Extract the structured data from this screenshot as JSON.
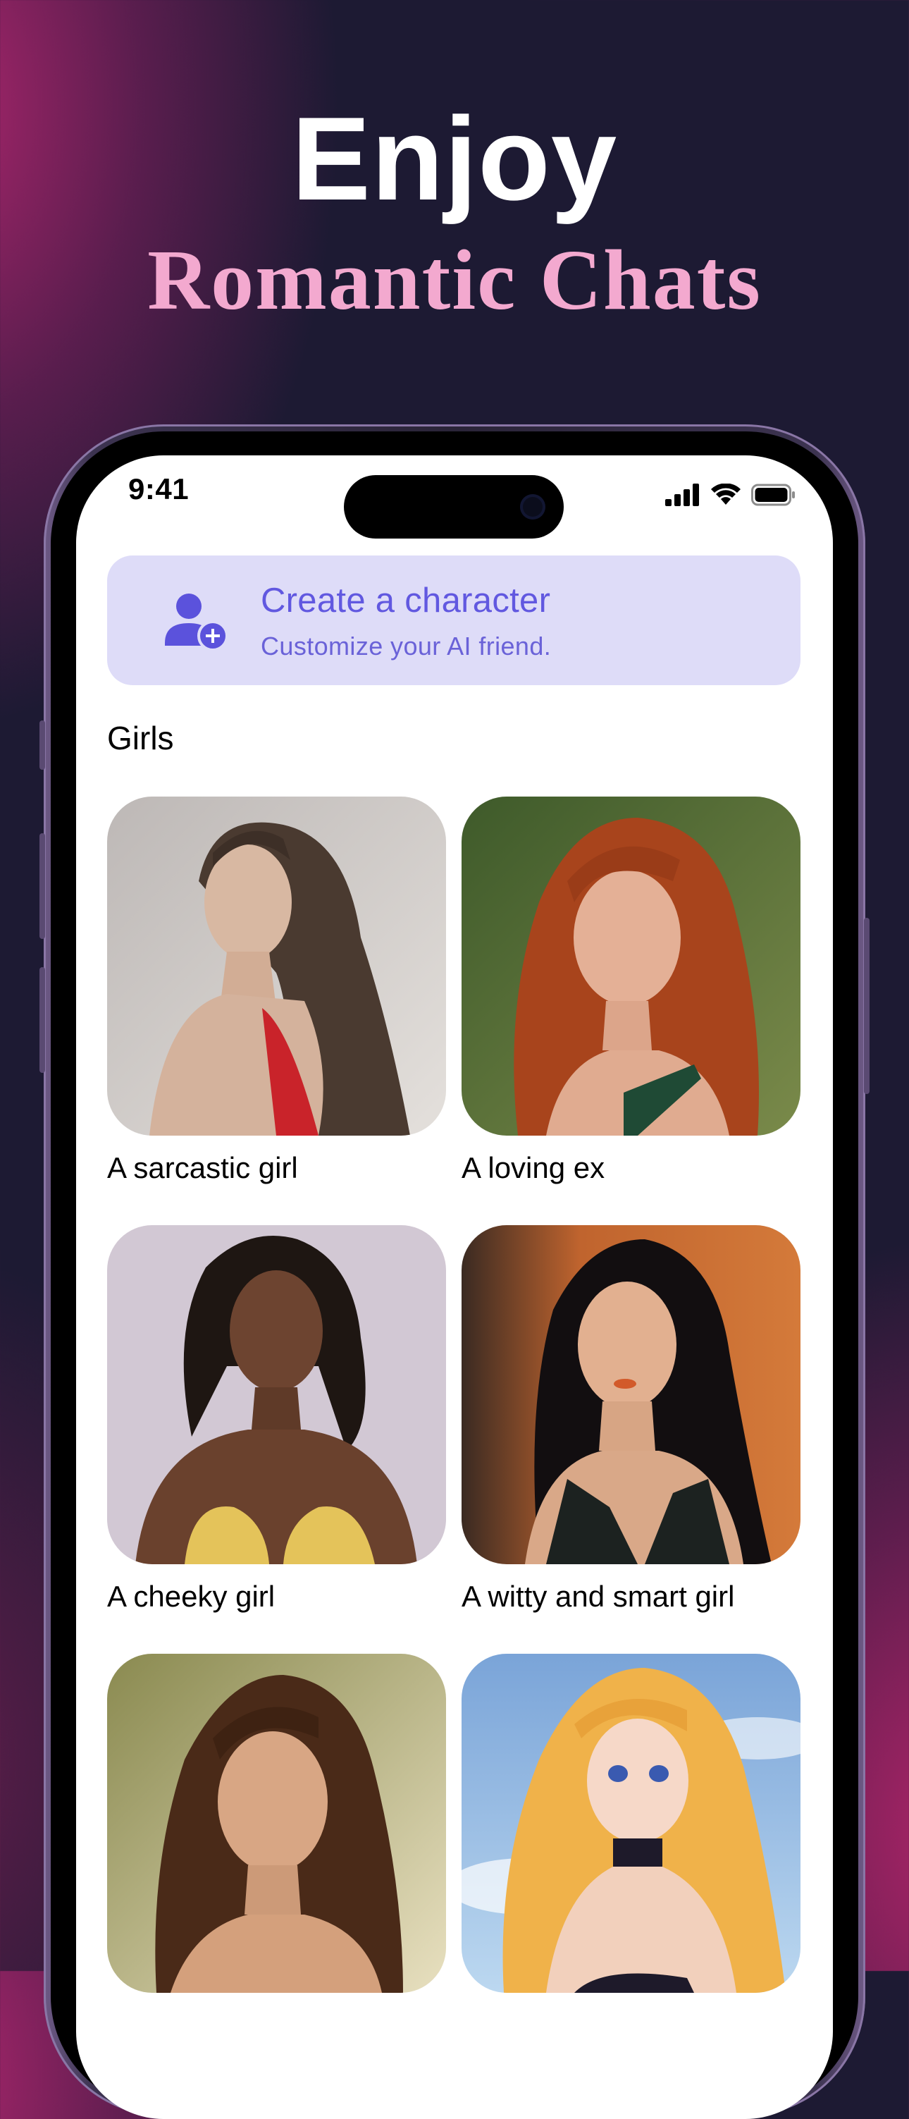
{
  "headline": {
    "main": "Enjoy",
    "sub": "Romantic Chats"
  },
  "status_bar": {
    "time": "9:41",
    "icons": [
      "signal-icon",
      "wifi-icon",
      "battery-icon"
    ]
  },
  "create_card": {
    "title": "Create a character",
    "subtitle": "Customize your AI friend.",
    "icon": "add-user-icon"
  },
  "section": {
    "title": "Girls"
  },
  "characters": [
    {
      "label": "A sarcastic girl"
    },
    {
      "label": "A loving ex"
    },
    {
      "label": "A cheeky girl"
    },
    {
      "label": "A witty and smart girl"
    },
    {
      "label": ""
    },
    {
      "label": ""
    }
  ],
  "colors": {
    "accent": "#6158e0",
    "card_bg": "#dedcf8",
    "headline_sub": "#f3a9cf"
  }
}
